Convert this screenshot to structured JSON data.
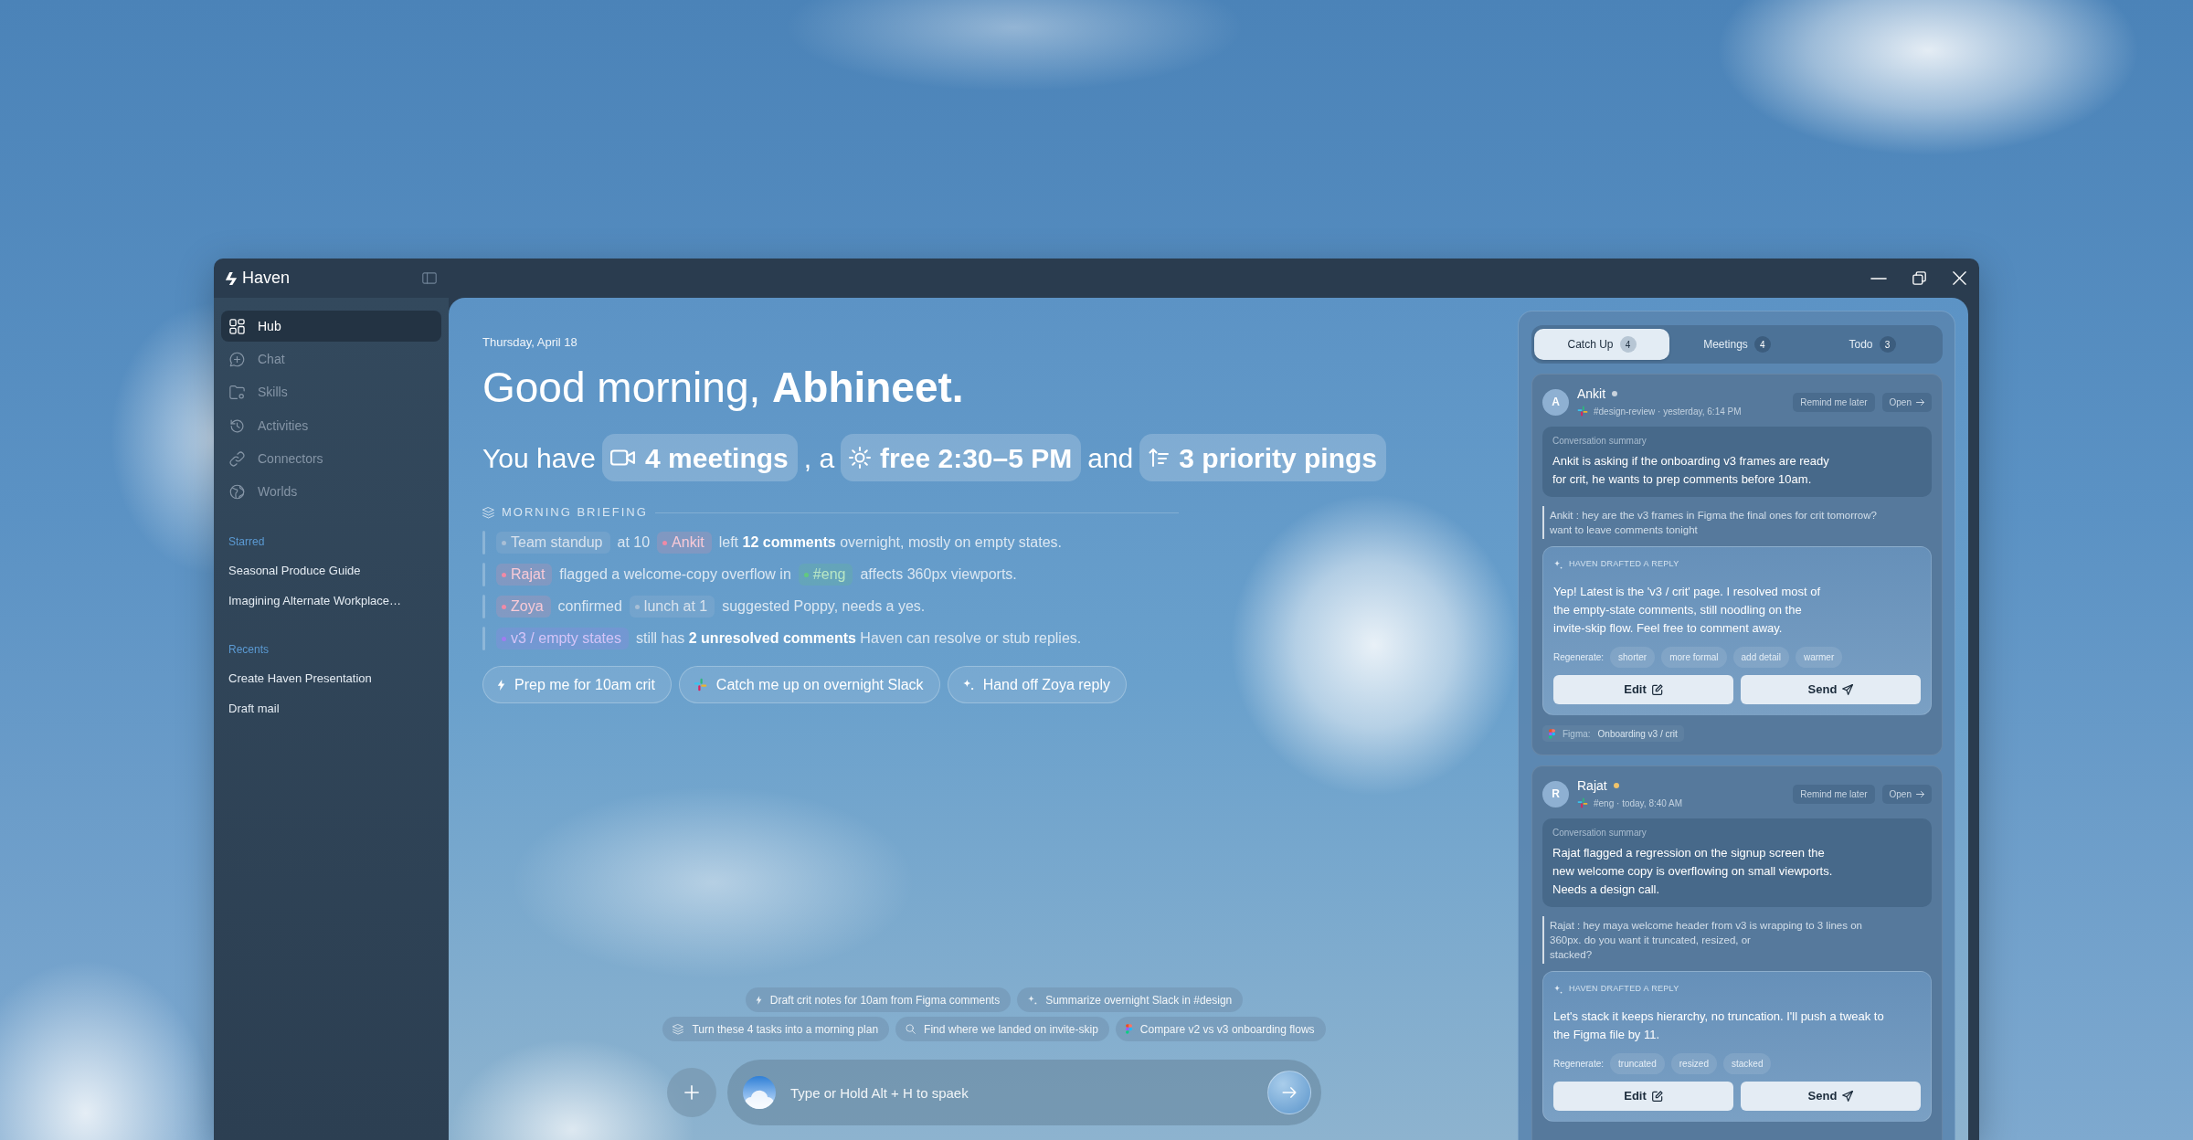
{
  "window": {
    "app_name": "Haven"
  },
  "sidebar": {
    "nav": [
      {
        "label": "Hub",
        "selected": true
      },
      {
        "label": "Chat",
        "selected": false
      },
      {
        "label": "Skills",
        "selected": false
      },
      {
        "label": "Activities",
        "selected": false
      },
      {
        "label": "Connectors",
        "selected": false
      },
      {
        "label": "Worlds",
        "selected": false
      }
    ],
    "sections": [
      {
        "title": "Starred",
        "items": [
          "Seasonal Produce Guide",
          "Imagining Alternate Workplace…"
        ]
      },
      {
        "title": "Recents",
        "items": [
          "Create Haven Presentation",
          "Draft mail"
        ]
      }
    ]
  },
  "hub": {
    "date": "Thursday, April 18",
    "greeting": "Good morning, **Abhineet.**",
    "summary": [
      {
        "kind": "text",
        "text": "You have"
      },
      {
        "kind": "pill",
        "text": "4 meetings"
      },
      {
        "kind": "text",
        "text": ", a"
      },
      {
        "kind": "pill",
        "text": "free 2:30–5 PM"
      },
      {
        "kind": "text",
        "text": "and"
      },
      {
        "kind": "pill",
        "text": "3 priority pings"
      }
    ],
    "briefing": {
      "title": "MORNING BRIEFING",
      "rows": [
        {
          "segments": [
            {
              "kind": "chip",
              "text": "Team standup",
              "color": "#a8bfd6"
            },
            {
              "kind": "text",
              "text": "at 10"
            },
            {
              "kind": "chip",
              "text": "Ankit",
              "color": "#f08aa6"
            },
            {
              "kind": "text",
              "text": "left **12 comments** overnight, mostly on empty states."
            }
          ]
        },
        {
          "segments": [
            {
              "kind": "chip",
              "text": "Rajat",
              "color": "#f08aa6"
            },
            {
              "kind": "text",
              "text": "flagged a welcome-copy overflow in"
            },
            {
              "kind": "chip",
              "text": "#eng",
              "color": "#62c97e"
            },
            {
              "kind": "text",
              "text": "affects 360px viewports."
            }
          ]
        },
        {
          "segments": [
            {
              "kind": "chip",
              "text": "Zoya",
              "color": "#f08aa6"
            },
            {
              "kind": "text",
              "text": "confirmed"
            },
            {
              "kind": "chip",
              "text": "lunch at 1",
              "color": "#a8bfd6"
            },
            {
              "kind": "text",
              "text": "suggested Poppy, needs a yes."
            }
          ]
        },
        {
          "segments": [
            {
              "kind": "chip",
              "text": "v3 / empty states",
              "color": "#a17cf0"
            },
            {
              "kind": "text",
              "text": "still has **2 unresolved comments** Haven can resolve or stub replies."
            }
          ]
        }
      ]
    },
    "actions": [
      "Prep me for 10am crit",
      "Catch me up on overnight Slack",
      "Hand off Zoya reply"
    ],
    "suggestions": [
      [
        "Draft crit notes for 10am from Figma comments",
        "Summarize overnight Slack in #design"
      ],
      [
        "Turn these 4 tasks into a morning plan",
        "Find where we landed on invite-skip",
        "Compare v2 vs v3 onboarding flows"
      ]
    ],
    "composer": {
      "placeholder": "Type or Hold Alt + H to spaek"
    }
  },
  "catch_up": {
    "tabs": [
      {
        "label": "Catch Up",
        "count": "4",
        "selected": true
      },
      {
        "label": "Meetings",
        "count": "4",
        "selected": false
      },
      {
        "label": "Todo",
        "count": "3",
        "selected": false
      }
    ],
    "cards": [
      {
        "sender": "Ankit",
        "initial": "A",
        "color": "#c8d2dc",
        "meta": "#design-review · yesterday, 6:14 PM",
        "remind": "Remind me later",
        "open": "Open",
        "summary_label": "Conversation summary",
        "summary": "Ankit is asking if the onboarding v3 frames are ready\nfor crit, he wants to prep comments before 10am.",
        "quote": "Ankit : hey are the v3 frames in Figma the final ones for crit tomorrow?\nwant to leave comments tonight",
        "draft_label": "HAVEN DRAFTED A REPLY",
        "draft": "Yep! Latest is the 'v3 / crit' page. I resolved most of\nthe empty-state comments, still noodling on the\ninvite-skip flow. Feel free to comment away.",
        "regenerate_label": "Regenerate:",
        "regenerate_options": [
          "shorter",
          "more formal",
          "add detail",
          "warmer"
        ],
        "edit": "Edit",
        "send": "Send",
        "source": {
          "app": "Figma:",
          "title": "Onboarding v3 / crit"
        }
      },
      {
        "sender": "Rajat",
        "initial": "R",
        "color": "#f0c36a",
        "meta": "#eng · today, 8:40 AM",
        "remind": "Remind me later",
        "open": "Open",
        "summary_label": "Conversation summary",
        "summary": "Rajat flagged a regression on the signup screen the\nnew welcome copy is overflowing on small viewports.\nNeeds a design call.",
        "quote": "Rajat : hey maya welcome header from v3 is wrapping to 3 lines on\n360px. do you want it truncated, resized, or\nstacked?",
        "draft_label": "HAVEN DRAFTED A REPLY",
        "draft": "Let's stack it keeps hierarchy, no truncation. I'll push a tweak to\nthe Figma file by 11.",
        "regenerate_label": "Regenerate:",
        "regenerate_options": [
          "truncated",
          "resized",
          "stacked"
        ],
        "edit": "Edit",
        "send": "Send"
      }
    ]
  }
}
